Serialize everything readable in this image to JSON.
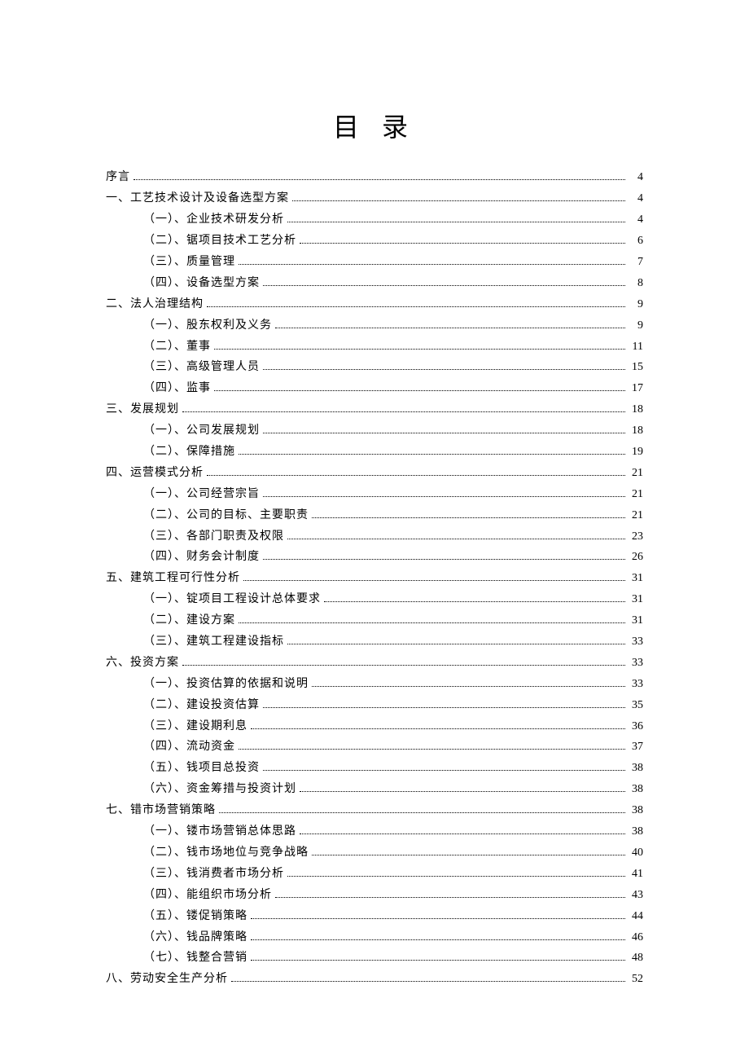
{
  "title": "目 录",
  "toc": [
    {
      "level": 0,
      "label": "序言",
      "page": "4"
    },
    {
      "level": 0,
      "label": "一、工艺技术设计及设备选型方案",
      "page": "4"
    },
    {
      "level": 1,
      "label": "（一）、企业技术研发分析",
      "page": "4"
    },
    {
      "level": 1,
      "label": "（二）、锯项目技术工艺分析",
      "page": "6"
    },
    {
      "level": 1,
      "label": "（三）、质量管理",
      "page": "7"
    },
    {
      "level": 1,
      "label": "（四）、设备选型方案",
      "page": "8"
    },
    {
      "level": 0,
      "label": "二、法人治理结构",
      "page": "9"
    },
    {
      "level": 1,
      "label": "（一）、股东权利及义务",
      "page": "9"
    },
    {
      "level": 1,
      "label": "（二）、董事",
      "page": "11"
    },
    {
      "level": 1,
      "label": "（三）、高级管理人员",
      "page": "15"
    },
    {
      "level": 1,
      "label": "（四）、监事",
      "page": "17"
    },
    {
      "level": 0,
      "label": "三、发展规划",
      "page": "18"
    },
    {
      "level": 1,
      "label": "（一）、公司发展规划",
      "page": "18"
    },
    {
      "level": 1,
      "label": "（二）、保障措施",
      "page": "19"
    },
    {
      "level": 0,
      "label": "四、运营模式分析",
      "page": "21"
    },
    {
      "level": 1,
      "label": "（一）、公司经营宗旨",
      "page": "21"
    },
    {
      "level": 1,
      "label": "（二）、公司的目标、主要职责",
      "page": "21"
    },
    {
      "level": 1,
      "label": "（三）、各部门职责及权限",
      "page": "23"
    },
    {
      "level": 1,
      "label": "（四）、财务会计制度",
      "page": "26"
    },
    {
      "level": 0,
      "label": "五、建筑工程可行性分析",
      "page": "31"
    },
    {
      "level": 1,
      "label": "（一）、锭项目工程设计总体要求",
      "page": "31"
    },
    {
      "level": 1,
      "label": "（二）、建设方案",
      "page": "31"
    },
    {
      "level": 1,
      "label": "（三）、建筑工程建设指标",
      "page": "33"
    },
    {
      "level": 0,
      "label": "六、投资方案",
      "page": "33"
    },
    {
      "level": 1,
      "label": "（一）、投资估算的依据和说明",
      "page": "33"
    },
    {
      "level": 1,
      "label": "（二）、建设投资估算",
      "page": "35"
    },
    {
      "level": 1,
      "label": "（三）、建设期利息",
      "page": "36"
    },
    {
      "level": 1,
      "label": "（四）、流动资金",
      "page": "37"
    },
    {
      "level": 1,
      "label": "（五）、钱项目总投资",
      "page": "38"
    },
    {
      "level": 1,
      "label": "（六）、资金筹措与投资计划",
      "page": "38"
    },
    {
      "level": 0,
      "label": "七、错市场营销策略",
      "page": "38"
    },
    {
      "level": 1,
      "label": "（一）、镂市场营销总体思路",
      "page": "38"
    },
    {
      "level": 1,
      "label": "（二）、钱市场地位与竞争战略",
      "page": "40"
    },
    {
      "level": 1,
      "label": "（三）、钱消费者市场分析",
      "page": "41"
    },
    {
      "level": 1,
      "label": "（四）、能组织市场分析",
      "page": "43"
    },
    {
      "level": 1,
      "label": "（五）、镂促销策略",
      "page": "44"
    },
    {
      "level": 1,
      "label": "（六）、钱品牌策略",
      "page": "46"
    },
    {
      "level": 1,
      "label": "（七）、钱整合营销",
      "page": "48"
    },
    {
      "level": 0,
      "label": "八、劳动安全生产分析",
      "page": "52"
    }
  ]
}
